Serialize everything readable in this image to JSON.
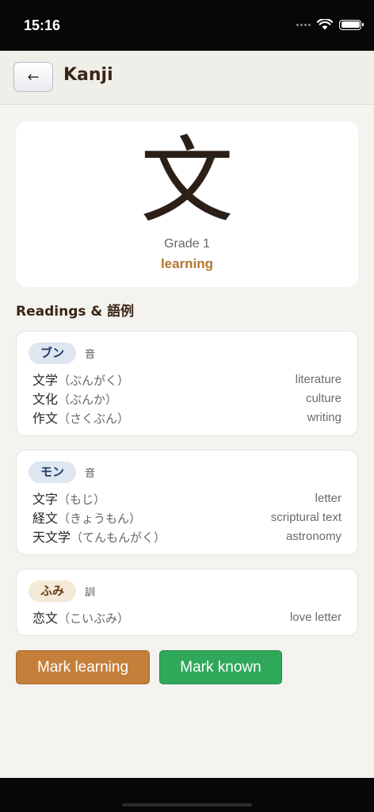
{
  "status_bar": {
    "time": "15:16"
  },
  "header": {
    "back_icon": "left-arrow",
    "back_symbol": "←",
    "title": "Kanji"
  },
  "kanji": {
    "character": "文",
    "grade": "Grade 1",
    "status": "learning"
  },
  "readings_title": "Readings & 語例",
  "readings": [
    {
      "reading": "ブン",
      "type": "音",
      "style": "on",
      "examples": [
        {
          "word": "文学",
          "kana": "（ぶんがく）",
          "meaning": "literature"
        },
        {
          "word": "文化",
          "kana": "（ぶんか）",
          "meaning": "culture"
        },
        {
          "word": "作文",
          "kana": "（さくぶん）",
          "meaning": "writing"
        }
      ]
    },
    {
      "reading": "モン",
      "type": "音",
      "style": "on",
      "examples": [
        {
          "word": "文字",
          "kana": "（もじ）",
          "meaning": "letter"
        },
        {
          "word": "経文",
          "kana": "（きょうもん）",
          "meaning": "scriptural text"
        },
        {
          "word": "天文学",
          "kana": "（てんもんがく）",
          "meaning": "astronomy"
        }
      ]
    },
    {
      "reading": "ふみ",
      "type": "訓",
      "style": "kun",
      "examples": [
        {
          "word": "恋文",
          "kana": "（こいぶみ）",
          "meaning": "love letter"
        }
      ]
    }
  ],
  "actions": {
    "mark_learning": "Mark learning",
    "mark_known": "Mark known"
  },
  "colors": {
    "accent_learning": "#c47f3a",
    "accent_known": "#2fa85a",
    "title": "#3a2618"
  }
}
